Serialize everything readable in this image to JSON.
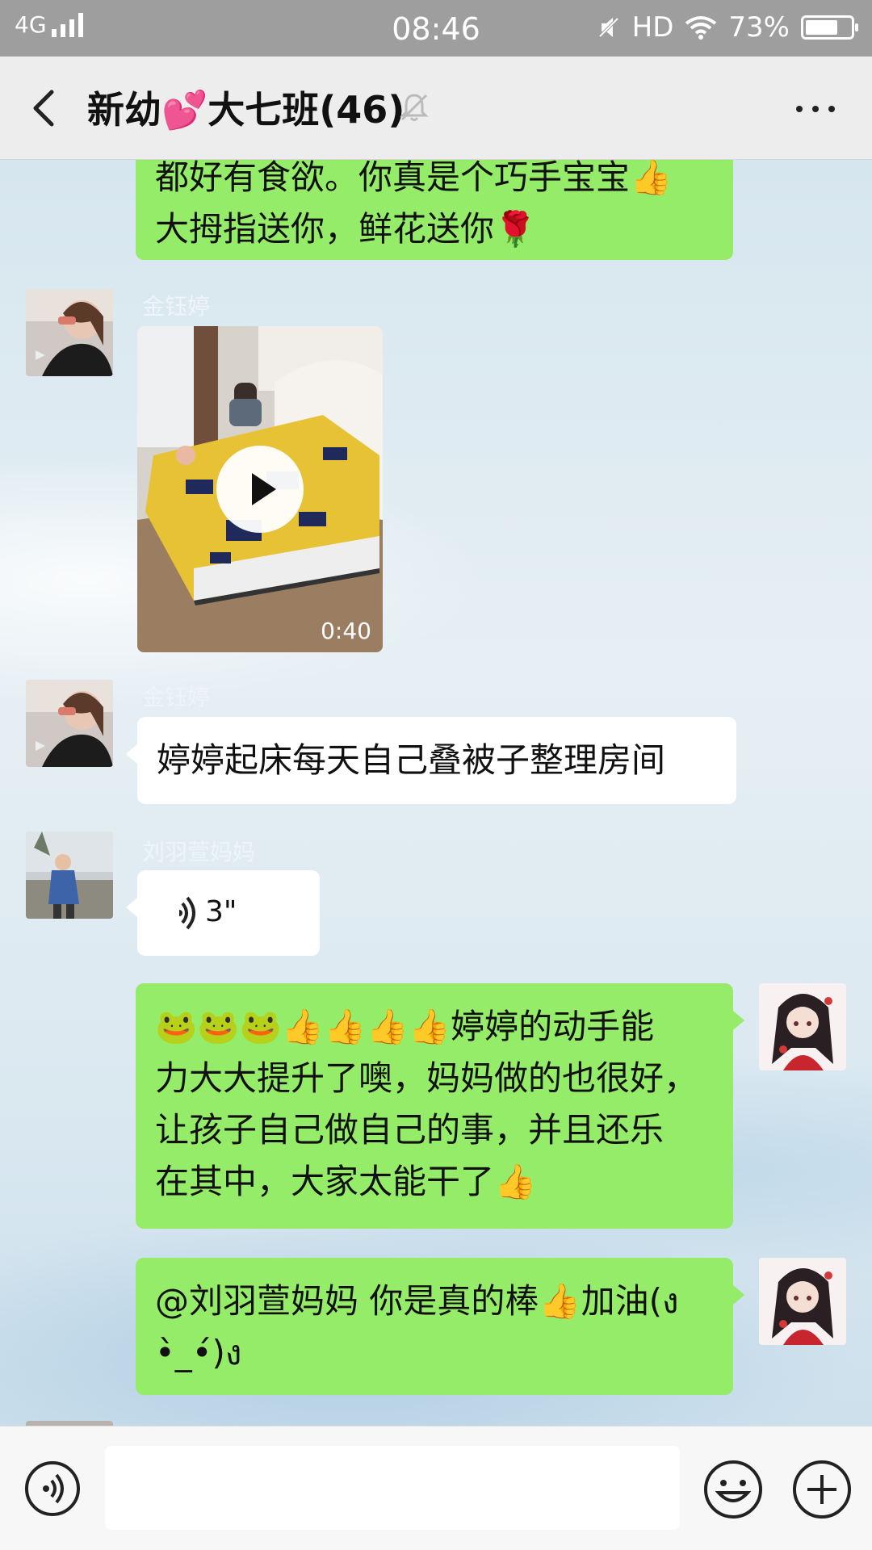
{
  "status_bar": {
    "network": "4G",
    "time": "08:46",
    "hd": "HD",
    "battery": "73%",
    "battery_level": 0.73
  },
  "header": {
    "title": "新幼💕大七班(46)",
    "back_icon": "chevron-left-icon",
    "mute_icon": "bell-muted-icon",
    "more_icon": "more-dots-icon"
  },
  "messages": [
    {
      "type": "text",
      "side": "right",
      "lines": [
        "都好有食欲。你真是个巧手宝宝👍",
        "大拇指送你，鲜花送你🌹"
      ]
    },
    {
      "type": "video",
      "side": "left",
      "sender": "金钰婷",
      "duration": "0:40"
    },
    {
      "type": "text",
      "side": "left",
      "sender": "金钰婷",
      "text": "婷婷起床每天自己叠被子整理房间"
    },
    {
      "type": "voice",
      "side": "left",
      "sender": "刘羽萱妈妈",
      "duration": "3\""
    },
    {
      "type": "text",
      "side": "right",
      "lines": [
        "🐸🐸🐸👍👍👍👍婷婷的动手能",
        "力大大提升了噢，妈妈做的也很好，",
        "让孩子自己做自己的事，并且还乐",
        "在其中，大家太能干了👍"
      ]
    },
    {
      "type": "text",
      "side": "right",
      "lines": [
        "@刘羽萱妈妈 你是真的棒👍加油(ง",
        "•̀_•́)ง"
      ]
    }
  ],
  "input_bar": {
    "voice_icon": "voice-icon",
    "emoji_icon": "smiley-icon",
    "plus_icon": "plus-icon",
    "text": ""
  }
}
